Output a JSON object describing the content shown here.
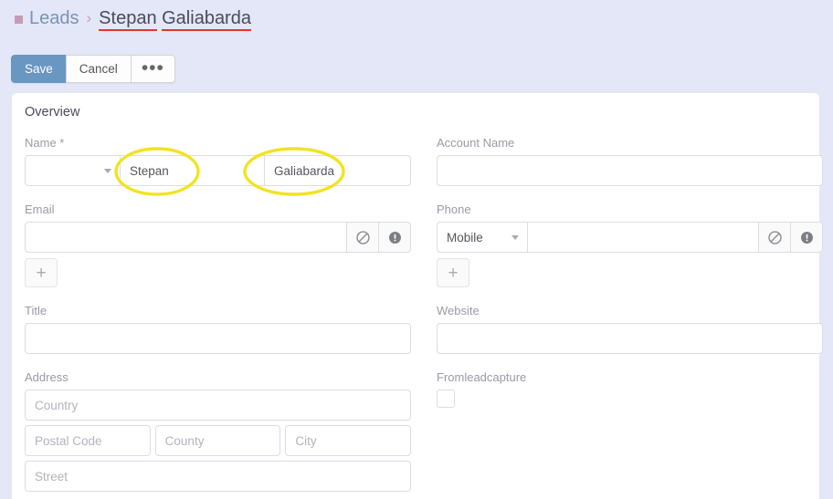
{
  "breadcrumb": {
    "icon": "leads-square-icon",
    "parent": "Leads",
    "separator": "›",
    "current_first": "Stepan",
    "current_space": " ",
    "current_last": "Galiabarda"
  },
  "toolbar": {
    "save_label": "Save",
    "cancel_label": "Cancel",
    "more_label": "•••"
  },
  "panel": {
    "title": "Overview"
  },
  "fields": {
    "name": {
      "label": "Name *",
      "salutation_value": "",
      "first_value": "Stepan",
      "last_value": "Galiabarda",
      "first_placeholder": "",
      "last_placeholder": ""
    },
    "account_name": {
      "label": "Account Name",
      "value": "",
      "placeholder": ""
    },
    "email": {
      "label": "Email",
      "value": "",
      "placeholder": "",
      "opt_out_icon": "circle-slash-icon",
      "invalid_icon": "exclamation-circle-icon",
      "add_label": "+"
    },
    "phone": {
      "label": "Phone",
      "type_value": "Mobile",
      "value": "",
      "placeholder": "",
      "opt_out_icon": "circle-slash-icon",
      "invalid_icon": "exclamation-circle-icon",
      "add_label": "+"
    },
    "title": {
      "label": "Title",
      "value": "",
      "placeholder": ""
    },
    "website": {
      "label": "Website",
      "value": "",
      "placeholder": ""
    },
    "address": {
      "label": "Address",
      "country_placeholder": "Country",
      "postal_placeholder": "Postal Code",
      "county_placeholder": "County",
      "city_placeholder": "City",
      "street_placeholder": "Street",
      "country_value": "",
      "postal_value": "",
      "county_value": "",
      "city_value": "",
      "street_value": ""
    },
    "fromleadcapture": {
      "label": "Fromleadcapture",
      "checked": false
    }
  },
  "annotations": {
    "color": "#f2e322",
    "items": [
      {
        "name": "highlight-first-name",
        "label": "ellipse around first name field"
      },
      {
        "name": "highlight-last-name",
        "label": "ellipse around last name field"
      }
    ]
  },
  "colors": {
    "page_background": "#e3e7f7",
    "primary_button": "#6a96c2",
    "breadcrumb_link": "#7b92b5",
    "breadcrumb_square": "#c49db5",
    "misspell_underline": "#e8332a",
    "annotation_yellow": "#f2e322"
  }
}
